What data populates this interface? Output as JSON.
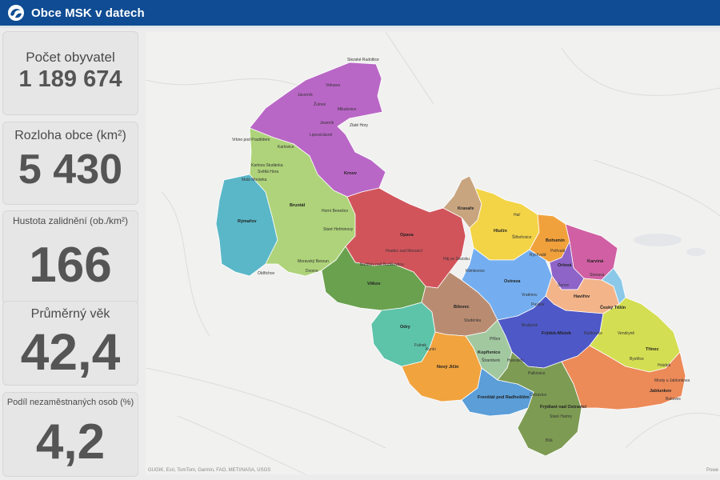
{
  "header": {
    "title": "Obce MSK v datech"
  },
  "stats": [
    {
      "label": "Počet obyvatel",
      "value": "1 189 674"
    },
    {
      "label": "Rozloha obce (km²)",
      "value": "5 430"
    },
    {
      "label": "Hustota zalidnění (ob./km²)",
      "value": "166"
    },
    {
      "label": "Průměrný věk",
      "value": "42,4"
    },
    {
      "label": "Podíl nezaměstnaných osob (%)",
      "value": "4,2"
    }
  ],
  "map": {
    "attribution": "GUGIK, Esri, TomTom, Garmin, FAO, METI/NASA, USGS",
    "powered": "Powe",
    "district_colors": {
      "jesenik": "#b967c6",
      "bruntal": "#aed37a",
      "bruntal_west": "#5ab7c8",
      "opava": "#d2545b",
      "vitkov": "#6aa14f",
      "odry": "#5dc3a9",
      "novy_jicin": "#f1a33e",
      "koprivnice": "#a2c8a0",
      "bilovec": "#b98c72",
      "frenstat": "#5b9ed8",
      "ostrava": "#74aef0",
      "hlucin": "#f3d447",
      "kravare": "#c8a57f",
      "bohumin": "#f1a13c",
      "karvina": "#d060a3",
      "orlova": "#8e64c8",
      "havirov": "#f3b48a",
      "frydek": "#4e58c6",
      "frydlant": "#7d9b53",
      "trinec": "#d4de52",
      "jablunkov": "#ec8a58",
      "cesky_tesin": "#8cc9e8"
    },
    "places": [
      {
        "name": "Slezské Rudoltice"
      },
      {
        "name": "Vidnava"
      },
      {
        "name": "Javorník"
      },
      {
        "name": "Žulová"
      },
      {
        "name": "Mikulovice"
      },
      {
        "name": "Zlaté Hory"
      },
      {
        "name": "Jeseník"
      },
      {
        "name": "Lipová-lázně"
      },
      {
        "name": "Vrbno pod Pradědem"
      },
      {
        "name": "Karlovice"
      },
      {
        "name": "Krnov"
      },
      {
        "name": "Karlova Studánka"
      },
      {
        "name": "Světlá Hora"
      },
      {
        "name": "Malá Morávka"
      },
      {
        "name": "Bruntál"
      },
      {
        "name": "Rýmařov"
      },
      {
        "name": "Horní Benešov"
      },
      {
        "name": "Staré Heřminovy"
      },
      {
        "name": "Opava"
      },
      {
        "name": "Kravaře"
      },
      {
        "name": "Hlučín"
      },
      {
        "name": "Bohumín"
      },
      {
        "name": "Karviná"
      },
      {
        "name": "Orlová"
      },
      {
        "name": "Ostrava"
      },
      {
        "name": "Havířov"
      },
      {
        "name": "Český Těšín"
      },
      {
        "name": "Vítkov"
      },
      {
        "name": "Bílovec"
      },
      {
        "name": "Odry"
      },
      {
        "name": "Nový Jičín"
      },
      {
        "name": "Kopřivnice"
      },
      {
        "name": "Frýdek-Místek"
      },
      {
        "name": "Třinec"
      },
      {
        "name": "Jablunkov"
      },
      {
        "name": "Frenštát pod Radhoštěm"
      },
      {
        "name": "Frýdlant nad Ostravicí"
      },
      {
        "name": "Budišov nad Budišovkou"
      },
      {
        "name": "Fulnek"
      },
      {
        "name": "Studénka"
      },
      {
        "name": "Příbor"
      },
      {
        "name": "Kunín"
      },
      {
        "name": "Bílá"
      },
      {
        "name": "Staré Hamry"
      },
      {
        "name": "Ostravice"
      },
      {
        "name": "Vendryně"
      },
      {
        "name": "Bystřice"
      },
      {
        "name": "Hrádek"
      },
      {
        "name": "Mosty u Jablunkova"
      },
      {
        "name": "Bukovec"
      },
      {
        "name": "Hradec nad Moravicí"
      },
      {
        "name": "Oldřichov"
      },
      {
        "name": "Moravský Beroun"
      },
      {
        "name": "Dvorce"
      },
      {
        "name": "Hať"
      },
      {
        "name": "Šilheřovice"
      },
      {
        "name": "Petřvald"
      },
      {
        "name": "Rychvald"
      },
      {
        "name": "Stonava"
      },
      {
        "name": "Šenov"
      },
      {
        "name": "Paskov"
      },
      {
        "name": "Brušperk"
      },
      {
        "name": "Raškovice"
      },
      {
        "name": "Vratimov"
      },
      {
        "name": "Klimkovice"
      },
      {
        "name": "Háj ve Slezsku"
      },
      {
        "name": "Štramberk"
      },
      {
        "name": "Hukvaldy"
      },
      {
        "name": "Palkovice"
      }
    ]
  }
}
